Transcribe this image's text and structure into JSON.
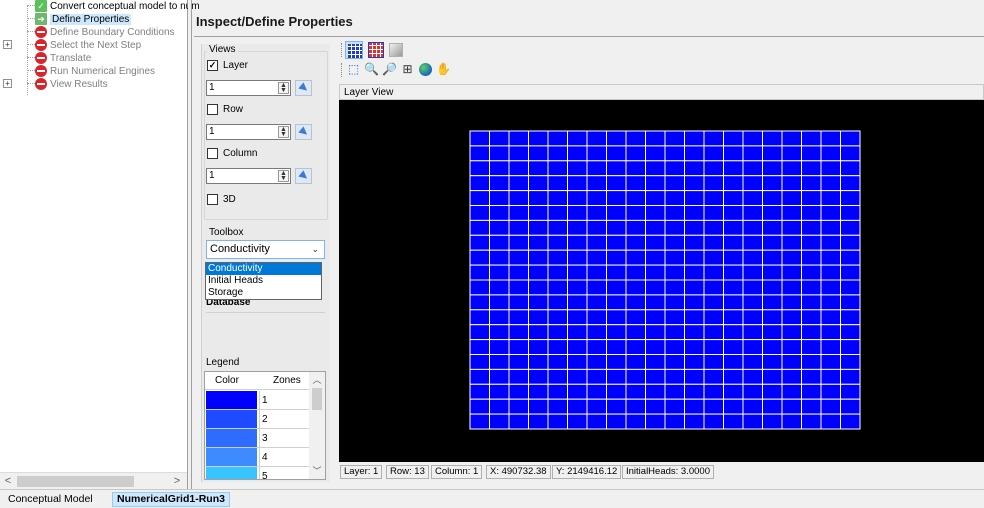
{
  "tree": {
    "items": [
      {
        "label": "Convert conceptual model to num",
        "icon": "check-icon",
        "active": true
      },
      {
        "label": "Define Properties",
        "icon": "arrow-icon",
        "active": true,
        "selected": true
      },
      {
        "label": "Define Boundary Conditions",
        "icon": "stop-icon",
        "active": false
      },
      {
        "label": "Select the Next Step",
        "icon": "stop-icon",
        "active": false,
        "expandable": true
      },
      {
        "label": "Translate",
        "icon": "stop-icon",
        "active": false
      },
      {
        "label": "Run Numerical Engines",
        "icon": "stop-icon",
        "active": false
      },
      {
        "label": "View Results",
        "icon": "stop-icon",
        "active": false,
        "expandable": true
      }
    ],
    "scroll_left": "<",
    "scroll_right": ">"
  },
  "header": {
    "title": "Inspect/Define Properties"
  },
  "views": {
    "group_title": "Views",
    "layer": {
      "label": "Layer",
      "checked": true,
      "value": "1"
    },
    "row": {
      "label": "Row",
      "checked": false,
      "value": "1"
    },
    "column": {
      "label": "Column",
      "checked": false,
      "value": "1"
    },
    "three_d": {
      "label": "3D",
      "checked": false
    }
  },
  "toolbox": {
    "group_title": "Toolbox",
    "selected": "Conductivity",
    "options": [
      "Conductivity",
      "Initial Heads",
      "Storage"
    ],
    "database_label": "Database"
  },
  "legend": {
    "label": "Legend",
    "col_color": "Color",
    "col_zones": "Zones",
    "rows": [
      {
        "zone": "1",
        "color": "#0000ff"
      },
      {
        "zone": "2",
        "color": "#1f4bff"
      },
      {
        "zone": "3",
        "color": "#2e6bff"
      },
      {
        "zone": "4",
        "color": "#3d8bff"
      },
      {
        "zone": "5",
        "color": "#38c4ff"
      }
    ]
  },
  "layer_view": {
    "header": "Layer View",
    "grid": {
      "rows": 20,
      "cols": 20,
      "cell_color": "#0000ff",
      "line_color": "#ffffff",
      "background": "#000000"
    }
  },
  "status": {
    "layer": "Layer: 1",
    "row": "Row: 13",
    "column": "Column: 1",
    "x": "X: 490732.38",
    "y": "Y: 2149416.12",
    "value": "InitialHeads: 3.0000"
  },
  "tabs": [
    {
      "label": "Conceptual Model",
      "active": false
    },
    {
      "label": "NumericalGrid1-Run3",
      "active": true
    }
  ]
}
